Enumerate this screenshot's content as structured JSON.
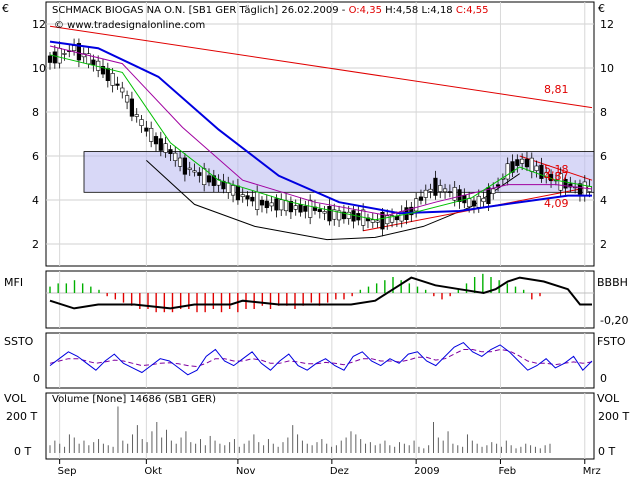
{
  "header": {
    "title": "SCHMACK BIOGAS NA O.N. [SB1 GER  Täglich] 26.02.2009 - ",
    "open": "O:4,35",
    "hlc": " H:4,58 L:4,18 ",
    "close": "C:4,55",
    "watermark": "© www.tradesignalonline.com",
    "currency": "€"
  },
  "panels": {
    "mfi": {
      "label": "MFI",
      "right_label": "BBBH",
      "right_tick": "-0,20"
    },
    "ssto": {
      "label": "SSTO",
      "right_label": "FSTO",
      "left_tick": "0",
      "right_tick": "0"
    },
    "vol": {
      "label": "VOL",
      "right_label": "VOL",
      "legend": "Volume [None] 14686 (SB1 GER)",
      "ticks": [
        "200 T",
        "0 T"
      ]
    }
  },
  "x_axis": [
    "Sep",
    "Okt",
    "Nov",
    "Dez",
    "2009",
    "Feb",
    "Mrz"
  ],
  "colors": {
    "up": "#ffffff",
    "down": "#000000",
    "ma_fast": "#00c000",
    "ma_mid": "#a000a0",
    "ma_slow": "#0000e0",
    "trend": "#e00000",
    "box": "#b8b8f0"
  },
  "chart_data": {
    "type": "candlestick",
    "y_ticks": [
      2,
      4,
      6,
      8,
      10,
      12
    ],
    "ylim": [
      1.0,
      13.0
    ],
    "annotations": [
      {
        "text": "8,81",
        "value": 8.81
      },
      {
        "text": "5,18",
        "value": 5.18
      },
      {
        "text": "4,87",
        "value": 4.87
      },
      {
        "text": "4,09",
        "value": 4.09
      }
    ],
    "range_box": {
      "top": 6.2,
      "bottom": 4.35
    },
    "close_path": [
      [
        0,
        10.4
      ],
      [
        5,
        10.6
      ],
      [
        10,
        10.9
      ],
      [
        15,
        10.5
      ],
      [
        20,
        10.1
      ],
      [
        25,
        9.6
      ],
      [
        30,
        9.0
      ],
      [
        35,
        8.0
      ],
      [
        40,
        7.2
      ],
      [
        45,
        6.6
      ],
      [
        50,
        6.2
      ],
      [
        55,
        5.6
      ],
      [
        60,
        5.3
      ],
      [
        65,
        5.0
      ],
      [
        70,
        4.8
      ],
      [
        75,
        4.5
      ],
      [
        80,
        4.2
      ],
      [
        85,
        4.0
      ],
      [
        90,
        3.8
      ],
      [
        95,
        3.8
      ],
      [
        100,
        3.7
      ],
      [
        105,
        3.6
      ],
      [
        110,
        3.6
      ],
      [
        115,
        3.4
      ],
      [
        120,
        3.3
      ],
      [
        125,
        3.3
      ],
      [
        130,
        3.2
      ],
      [
        135,
        3.0
      ],
      [
        140,
        3.1
      ],
      [
        145,
        3.2
      ],
      [
        150,
        3.5
      ],
      [
        155,
        4.2
      ],
      [
        160,
        4.6
      ],
      [
        165,
        4.4
      ],
      [
        170,
        4.2
      ],
      [
        175,
        3.8
      ],
      [
        180,
        4.0
      ],
      [
        185,
        4.5
      ],
      [
        190,
        5.3
      ],
      [
        195,
        5.8
      ],
      [
        200,
        5.6
      ],
      [
        205,
        5.2
      ],
      [
        210,
        4.9
      ],
      [
        215,
        4.7
      ],
      [
        220,
        4.5
      ],
      [
        225,
        4.5
      ]
    ],
    "ma_fast": [
      [
        0,
        10.6
      ],
      [
        30,
        9.8
      ],
      [
        50,
        6.6
      ],
      [
        70,
        4.9
      ],
      [
        100,
        3.9
      ],
      [
        135,
        3.1
      ],
      [
        150,
        3.4
      ],
      [
        175,
        4.1
      ],
      [
        195,
        5.5
      ],
      [
        210,
        4.9
      ],
      [
        225,
        4.6
      ]
    ],
    "ma_mid": [
      [
        0,
        11.0
      ],
      [
        30,
        10.2
      ],
      [
        55,
        7.3
      ],
      [
        80,
        4.9
      ],
      [
        110,
        3.9
      ],
      [
        140,
        3.3
      ],
      [
        160,
        3.9
      ],
      [
        190,
        4.7
      ],
      [
        210,
        4.7
      ],
      [
        225,
        4.5
      ]
    ],
    "ma_slow": [
      [
        0,
        11.2
      ],
      [
        20,
        10.9
      ],
      [
        45,
        9.6
      ],
      [
        70,
        7.2
      ],
      [
        95,
        5.1
      ],
      [
        120,
        3.9
      ],
      [
        145,
        3.4
      ],
      [
        170,
        3.5
      ],
      [
        195,
        3.9
      ],
      [
        215,
        4.2
      ],
      [
        225,
        4.2
      ]
    ],
    "arc": [
      [
        40,
        5.8
      ],
      [
        60,
        3.8
      ],
      [
        85,
        2.8
      ],
      [
        115,
        2.2
      ],
      [
        135,
        2.3
      ],
      [
        155,
        2.8
      ],
      [
        175,
        3.7
      ],
      [
        195,
        5.2
      ]
    ],
    "trend_down": [
      [
        0,
        11.9
      ],
      [
        225,
        8.2
      ]
    ],
    "wedge_upper": [
      [
        195,
        6.0
      ],
      [
        225,
        4.9
      ]
    ],
    "wedge_lower": [
      [
        130,
        2.6
      ],
      [
        225,
        4.6
      ]
    ],
    "mfi_bars": [
      2,
      3,
      3,
      4,
      3,
      2,
      1,
      -1,
      -2,
      -3,
      -4,
      -5,
      -5,
      -6,
      -6,
      -6,
      -5,
      -5,
      -6,
      -6,
      -5,
      -6,
      -5,
      -6,
      -5,
      -5,
      -4,
      -5,
      -4,
      -4,
      -5,
      -4,
      -3,
      -4,
      -3,
      -2,
      -2,
      -1,
      1,
      2,
      3,
      4,
      5,
      4,
      3,
      2,
      1,
      -1,
      -2,
      -1,
      1,
      3,
      5,
      6,
      5,
      4,
      3,
      2,
      1,
      -2,
      -1
    ],
    "mfi_line": [
      [
        0,
        -2
      ],
      [
        10,
        -4
      ],
      [
        20,
        -3
      ],
      [
        35,
        -3
      ],
      [
        50,
        -4
      ],
      [
        60,
        -3
      ],
      [
        75,
        -3
      ],
      [
        80,
        -2
      ],
      [
        95,
        -3
      ],
      [
        105,
        -3
      ],
      [
        115,
        -3
      ],
      [
        125,
        -3
      ],
      [
        135,
        -2
      ],
      [
        145,
        2
      ],
      [
        150,
        4
      ],
      [
        160,
        2
      ],
      [
        170,
        1
      ],
      [
        180,
        0
      ],
      [
        185,
        1
      ],
      [
        190,
        3
      ],
      [
        195,
        4
      ],
      [
        205,
        3
      ],
      [
        215,
        1
      ],
      [
        220,
        -3
      ],
      [
        225,
        -3
      ]
    ],
    "ssto_k": [
      40,
      55,
      70,
      60,
      45,
      30,
      50,
      65,
      45,
      35,
      25,
      40,
      55,
      50,
      35,
      20,
      30,
      60,
      75,
      50,
      40,
      55,
      70,
      45,
      30,
      50,
      65,
      40,
      30,
      45,
      55,
      40,
      30,
      60,
      70,
      50,
      40,
      55,
      45,
      65,
      70,
      50,
      40,
      60,
      80,
      90,
      70,
      60,
      75,
      85,
      70,
      50,
      30,
      40,
      55,
      35,
      45,
      60,
      30,
      50
    ],
    "ssto_d": [
      45,
      50,
      55,
      55,
      50,
      45,
      48,
      52,
      50,
      45,
      40,
      42,
      45,
      46,
      44,
      40,
      38,
      45,
      55,
      55,
      50,
      50,
      55,
      52,
      45,
      45,
      50,
      48,
      44,
      44,
      47,
      45,
      42,
      48,
      55,
      55,
      50,
      50,
      48,
      52,
      58,
      58,
      52,
      55,
      65,
      75,
      75,
      70,
      70,
      75,
      72,
      62,
      50,
      45,
      45,
      42,
      45,
      48,
      45,
      48
    ],
    "volume": [
      5,
      8,
      6,
      4,
      12,
      10,
      6,
      8,
      5,
      7,
      9,
      6,
      5,
      4,
      30,
      8,
      6,
      12,
      18,
      9,
      7,
      14,
      20,
      10,
      15,
      8,
      6,
      10,
      14,
      7,
      6,
      9,
      5,
      11,
      8,
      6,
      5,
      7,
      9,
      4,
      6,
      8,
      12,
      7,
      5,
      9,
      6,
      4,
      7,
      10,
      18,
      12,
      8,
      6,
      5,
      7,
      9,
      6,
      4,
      5,
      8,
      10,
      14,
      12,
      9,
      6,
      7,
      5,
      6,
      8,
      5,
      4,
      7,
      6,
      5,
      8,
      4,
      3,
      5,
      20,
      10,
      8,
      14,
      6,
      5,
      4,
      12,
      8,
      6,
      4,
      5,
      7,
      6,
      4,
      8,
      5,
      3,
      4,
      6,
      5,
      4,
      3,
      5,
      6
    ]
  }
}
